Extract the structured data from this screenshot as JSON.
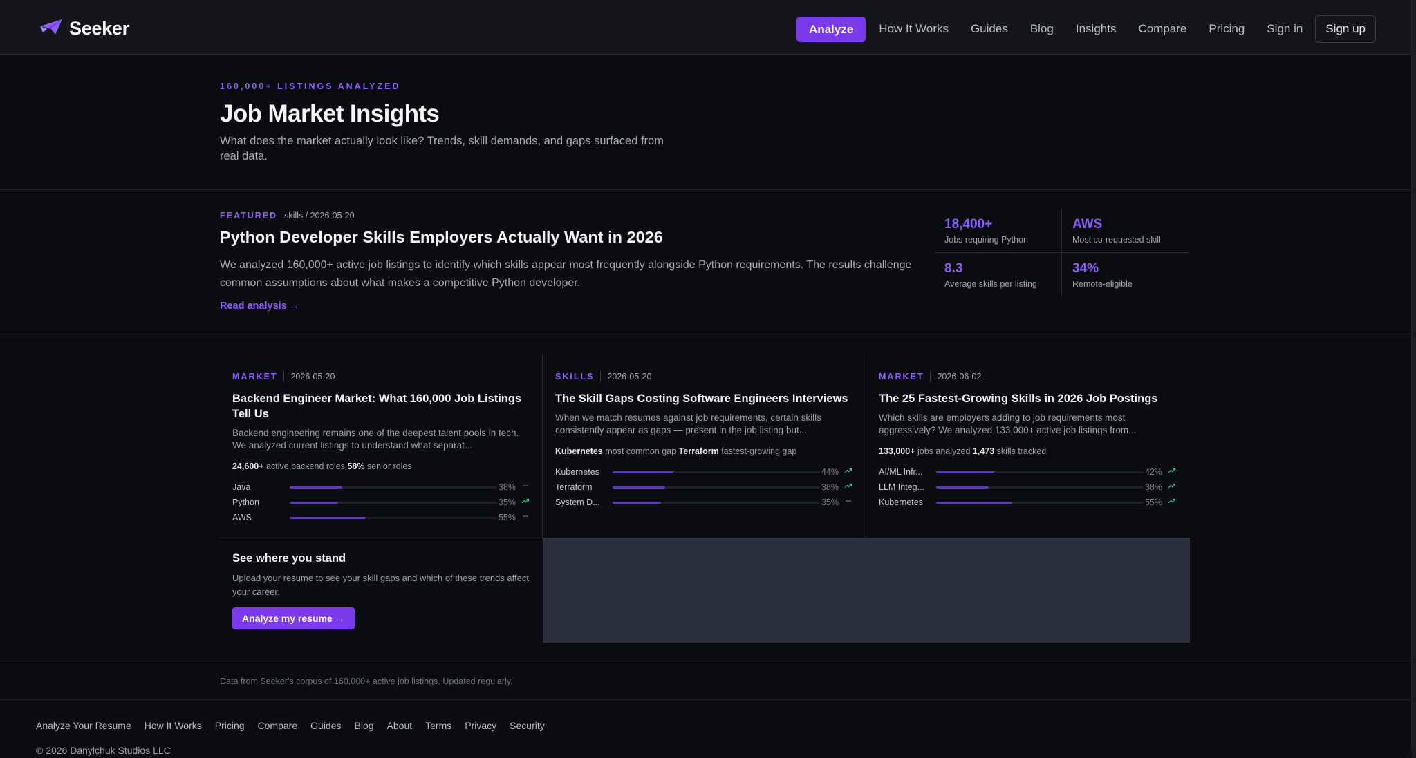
{
  "brand": {
    "name": "Seeker",
    "logo_icon": "paper-plane-icon",
    "accent": "#8b5cf6"
  },
  "nav": {
    "analyze": "Analyze",
    "items": [
      "How It Works",
      "Guides",
      "Blog",
      "Insights",
      "Compare",
      "Pricing",
      "Sign in"
    ],
    "signup": "Sign up"
  },
  "hero": {
    "eyebrow": "160,000+ LISTINGS ANALYZED",
    "title": "Job Market Insights",
    "subtitle": "What does the market actually look like? Trends, skill demands, and gaps surfaced from real data."
  },
  "featured": {
    "tag": "FEATURED",
    "category_date": "skills / 2026-05-20",
    "title": "Python Developer Skills Employers Actually Want in 2026",
    "description": "We analyzed 160,000+ active job listings to identify which skills appear most frequently alongside Python requirements. The results challenge common assumptions about what makes a competitive Python developer.",
    "link": "Read analysis →",
    "stats": [
      {
        "value": "18,400+",
        "label": "Jobs requiring Python"
      },
      {
        "value": "AWS",
        "label": "Most co-requested skill"
      },
      {
        "value": "8.3",
        "label": "Average skills per listing"
      },
      {
        "value": "34%",
        "label": "Remote-eligible"
      }
    ]
  },
  "cards": [
    {
      "tag": "MARKET",
      "date": "2026-05-20",
      "title": "Backend Engineer Market: What 160,000 Job Listings Tell Us",
      "desc": "Backend engineering remains one of the deepest talent pools in tech. We analyzed current listings to understand what separat...",
      "stats": [
        {
          "bold": "24,600+",
          "text": "active backend roles"
        },
        {
          "bold": "58%",
          "text": "senior roles"
        }
      ],
      "rows": [
        {
          "name": "Java",
          "pct": "38%",
          "value": 38,
          "trend": "flat"
        },
        {
          "name": "Python",
          "pct": "35%",
          "value": 35,
          "trend": "up"
        },
        {
          "name": "AWS",
          "pct": "55%",
          "value": 55,
          "trend": "flat"
        }
      ]
    },
    {
      "tag": "SKILLS",
      "date": "2026-05-20",
      "title": "The Skill Gaps Costing Software Engineers Interviews",
      "desc": "When we match resumes against job requirements, certain skills consistently appear as gaps — present in the job listing but...",
      "stats": [
        {
          "bold": "Kubernetes",
          "text": "most common gap"
        },
        {
          "bold": "Terraform",
          "text": "fastest-growing gap"
        }
      ],
      "rows": [
        {
          "name": "Kubernetes",
          "pct": "44%",
          "value": 44,
          "trend": "up"
        },
        {
          "name": "Terraform",
          "pct": "38%",
          "value": 38,
          "trend": "up"
        },
        {
          "name": "System D...",
          "pct": "35%",
          "value": 35,
          "trend": "flat"
        }
      ]
    },
    {
      "tag": "MARKET",
      "date": "2026-06-02",
      "title": "The 25 Fastest-Growing Skills in 2026 Job Postings",
      "desc": "Which skills are employers adding to job requirements most aggressively? We analyzed 133,000+ active job listings from...",
      "stats": [
        {
          "bold": "133,000+",
          "text": "jobs analyzed"
        },
        {
          "bold": "1,473",
          "text": "skills tracked"
        }
      ],
      "rows": [
        {
          "name": "AI/ML Infr...",
          "pct": "42%",
          "value": 42,
          "trend": "up"
        },
        {
          "name": "LLM Integ...",
          "pct": "38%",
          "value": 38,
          "trend": "up"
        },
        {
          "name": "Kubernetes",
          "pct": "55%",
          "value": 55,
          "trend": "up"
        }
      ]
    }
  ],
  "cta": {
    "title": "See where you stand",
    "desc": "Upload your resume to see your skill gaps and which of these trends affect your career.",
    "button": "Analyze my resume →"
  },
  "footnote": "Data from Seeker's corpus of 160,000+ active job listings. Updated regularly.",
  "footer": {
    "links": [
      "Analyze Your Resume",
      "How It Works",
      "Pricing",
      "Compare",
      "Guides",
      "Blog",
      "About",
      "Terms",
      "Privacy",
      "Security"
    ],
    "copyright": "© 2026 Danylchuk Studios LLC"
  }
}
